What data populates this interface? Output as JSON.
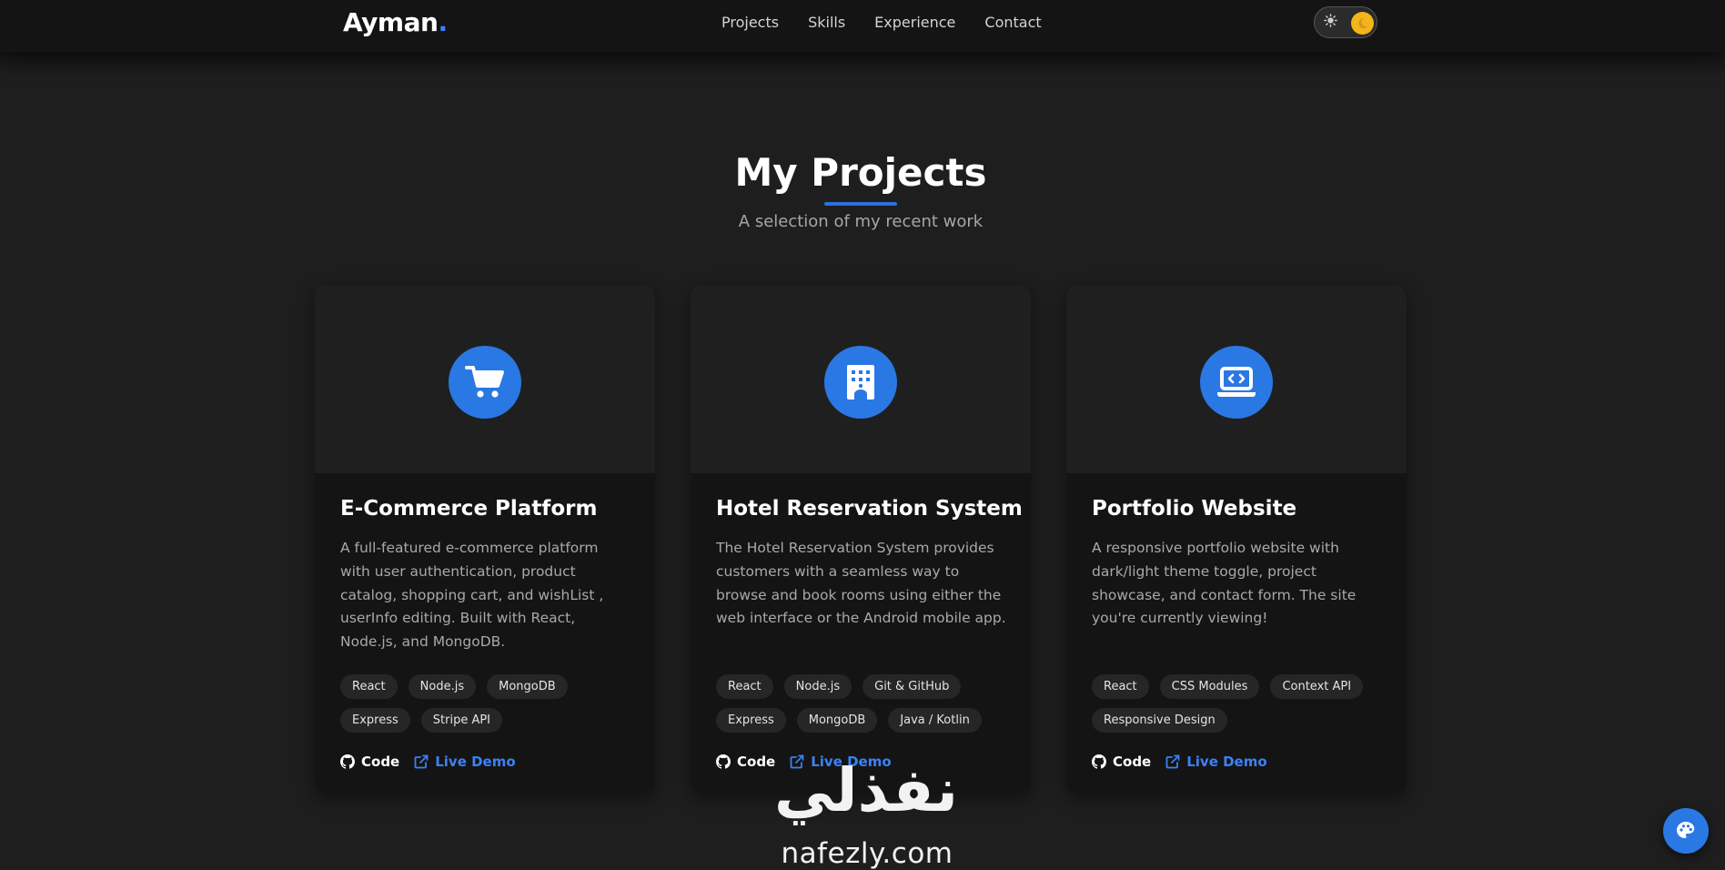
{
  "header": {
    "logo_text": "Ayman",
    "logo_dot": ".",
    "nav": [
      "Projects",
      "Skills",
      "Experience",
      "Contact"
    ],
    "theme_toggle": {
      "mode": "dark",
      "sun_icon": "sun-icon",
      "moon_icon": "moon-icon"
    }
  },
  "section": {
    "title": "My Projects",
    "subtitle": "A selection of my recent work"
  },
  "projects": [
    {
      "icon": "shopping-cart-icon",
      "title": "E-Commerce Platform",
      "description": "A full-featured e-commerce platform with user authentication, product catalog, shopping cart, and wishList , userInfo editing. Built with React, Node.js, and MongoDB.",
      "tags": [
        "React",
        "Node.js",
        "MongoDB",
        "Express",
        "Stripe API"
      ],
      "code_label": "Code",
      "demo_label": "Live Demo"
    },
    {
      "icon": "hotel-building-icon",
      "title": "Hotel Reservation System",
      "description": "The Hotel Reservation System provides customers with a seamless way to browse and book rooms using either the web interface or the Android mobile app.",
      "tags": [
        "React",
        "Node.js",
        "Git & GitHub",
        "Express",
        "MongoDB",
        "Java / Kotlin"
      ],
      "code_label": "Code",
      "demo_label": "Live Demo"
    },
    {
      "icon": "laptop-code-icon",
      "title": "Portfolio Website",
      "description": "A responsive portfolio website with dark/light theme toggle, project showcase, and contact form. The site you're currently viewing!",
      "tags": [
        "React",
        "CSS Modules",
        "Context API",
        "Responsive Design"
      ],
      "code_label": "Code",
      "demo_label": "Live Demo"
    }
  ],
  "watermark": {
    "arabic": "نفذلي",
    "latin": "nafezly.com"
  },
  "floating_button": {
    "icon": "palette-icon"
  },
  "colors": {
    "accent": "#2a78e4",
    "link": "#3b82f6",
    "background": "#1e1e1f",
    "card": "#141414",
    "moon_knob": "#f3b51c"
  }
}
